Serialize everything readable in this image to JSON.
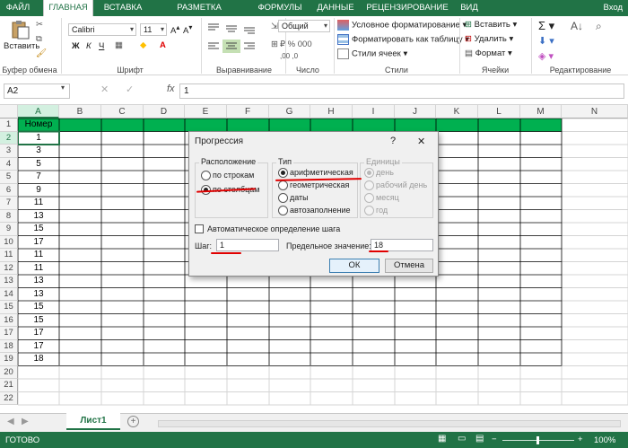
{
  "tabs": [
    "ФАЙЛ",
    "ГЛАВНАЯ",
    "ВСТАВКА",
    "РАЗМЕТКА СТРАНИЦЫ",
    "ФОРМУЛЫ",
    "ДАННЫЕ",
    "РЕЦЕНЗИРОВАНИЕ",
    "ВИД"
  ],
  "user": "Вход",
  "ribbon": {
    "paste": "Вставить",
    "font_name": "Calibri",
    "font_size": "11",
    "bold": "Ж",
    "italic": "К",
    "underline": "Ч",
    "number_format": "Общий",
    "cond_format": "Условное форматирование",
    "format_table": "Форматировать как таблицу",
    "cell_styles": "Стили ячеек",
    "insert": "Вставить",
    "delete": "Удалить",
    "format": "Формат",
    "groups": [
      "Буфер обмена",
      "Шрифт",
      "Выравнивание",
      "Число",
      "Стили",
      "Ячейки",
      "Редактирование"
    ]
  },
  "formula_bar": {
    "name_box": "A2",
    "fx": "fx",
    "value": "1"
  },
  "columns": [
    "A",
    "B",
    "C",
    "D",
    "E",
    "F",
    "G",
    "H",
    "I",
    "J",
    "K",
    "L",
    "M",
    "N"
  ],
  "rows": [
    "1",
    "2",
    "3",
    "4",
    "5",
    "6",
    "7",
    "8",
    "9",
    "10",
    "11",
    "12",
    "13",
    "14",
    "15",
    "16",
    "17",
    "18",
    "19",
    "20",
    "21",
    "22"
  ],
  "cells_a": [
    "Номер",
    "1",
    "3",
    "5",
    "7",
    "9",
    "11",
    "13",
    "15",
    "17",
    "11",
    "11",
    "13",
    "13",
    "15",
    "15",
    "17",
    "17",
    "18",
    "",
    "",
    ""
  ],
  "dialog": {
    "title": "Прогрессия",
    "help": "?",
    "close": "✕",
    "placement_title": "Расположение",
    "by_rows": "по строкам",
    "by_cols": "по столбцам",
    "type_title": "Тип",
    "arith": "арифметическая",
    "geom": "геометрическая",
    "dates": "даты",
    "autofill": "автозаполнение",
    "units_title": "Единицы",
    "day": "день",
    "workday": "рабочий день",
    "month": "месяц",
    "year": "год",
    "auto_step": "Автоматическое определение шага",
    "step_label": "Шаг:",
    "step_value": "1",
    "limit_label": "Предельное значение:",
    "limit_value": "18",
    "ok": "ОК",
    "cancel": "Отмена"
  },
  "sheet_tab": "Лист1",
  "status": "ГОТОВО",
  "zoom": "100%",
  "colors": {
    "excel_green": "#217346",
    "header_green": "#00b050",
    "annotation_red": "#e00000"
  }
}
